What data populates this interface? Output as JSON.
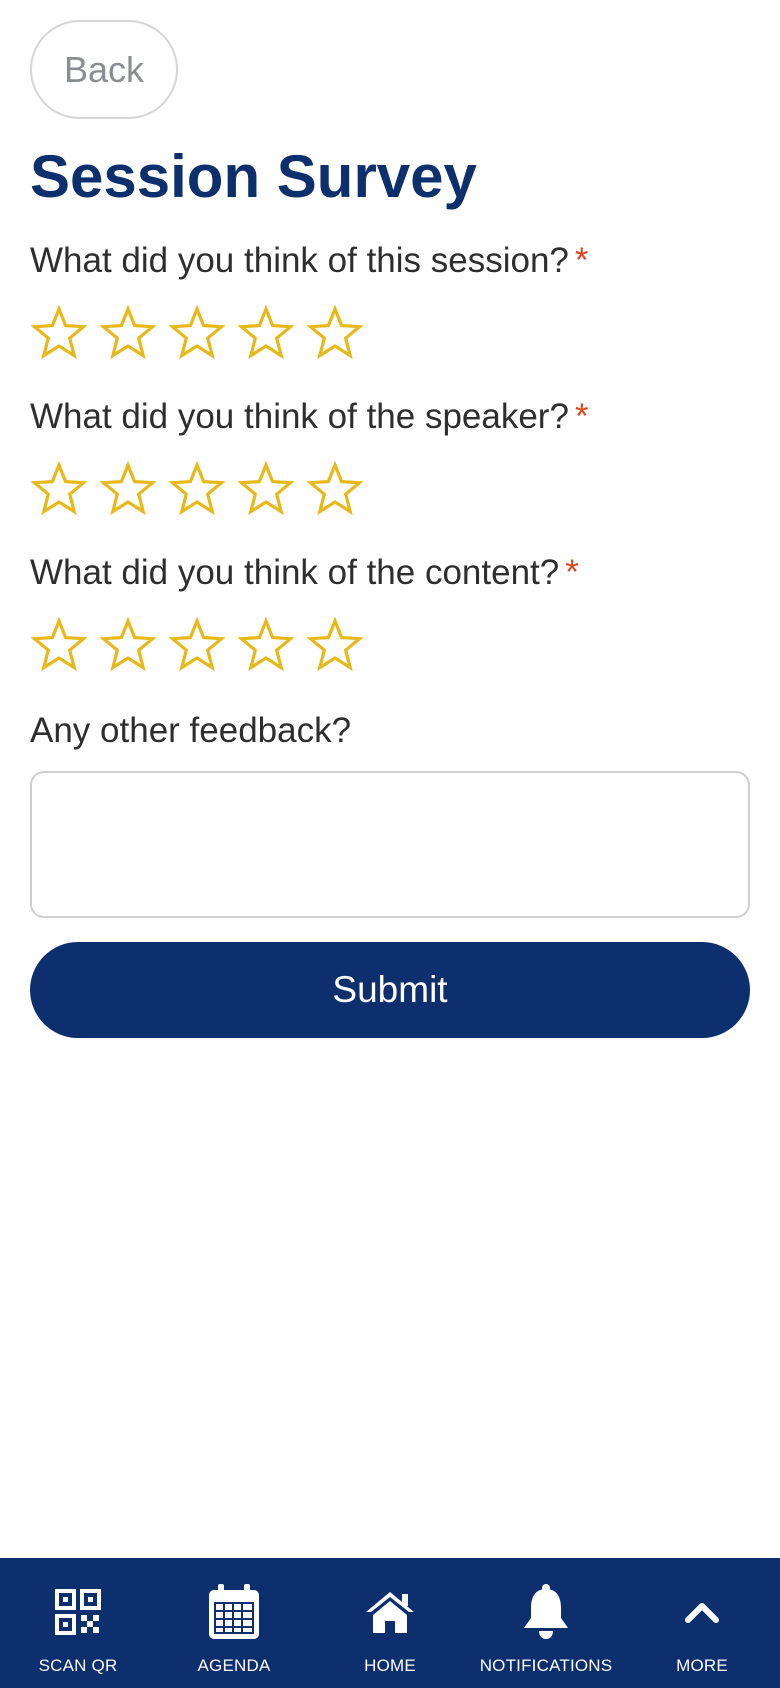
{
  "header": {
    "back_label": "Back",
    "title": "Session Survey"
  },
  "questions": [
    {
      "label": "What did you think of this session?",
      "required_mark": "*",
      "rating": 0,
      "max": 5
    },
    {
      "label": "What did you think of the speaker?",
      "required_mark": "*",
      "rating": 0,
      "max": 5
    },
    {
      "label": "What did you think of the content?",
      "required_mark": "*",
      "rating": 0,
      "max": 5
    }
  ],
  "feedback": {
    "label": "Any other feedback?",
    "value": "",
    "placeholder": ""
  },
  "submit_label": "Submit",
  "bottom_nav": [
    {
      "label": "SCAN QR",
      "icon": "qr-code-icon"
    },
    {
      "label": "AGENDA",
      "icon": "calendar-icon"
    },
    {
      "label": "HOME",
      "icon": "home-icon"
    },
    {
      "label": "NOTIFICATIONS",
      "icon": "bell-icon"
    },
    {
      "label": "MORE",
      "icon": "chevron-up-icon"
    }
  ],
  "colors": {
    "brand": "#0e2f6e",
    "star": "#e6b818",
    "required": "#d9481c"
  }
}
